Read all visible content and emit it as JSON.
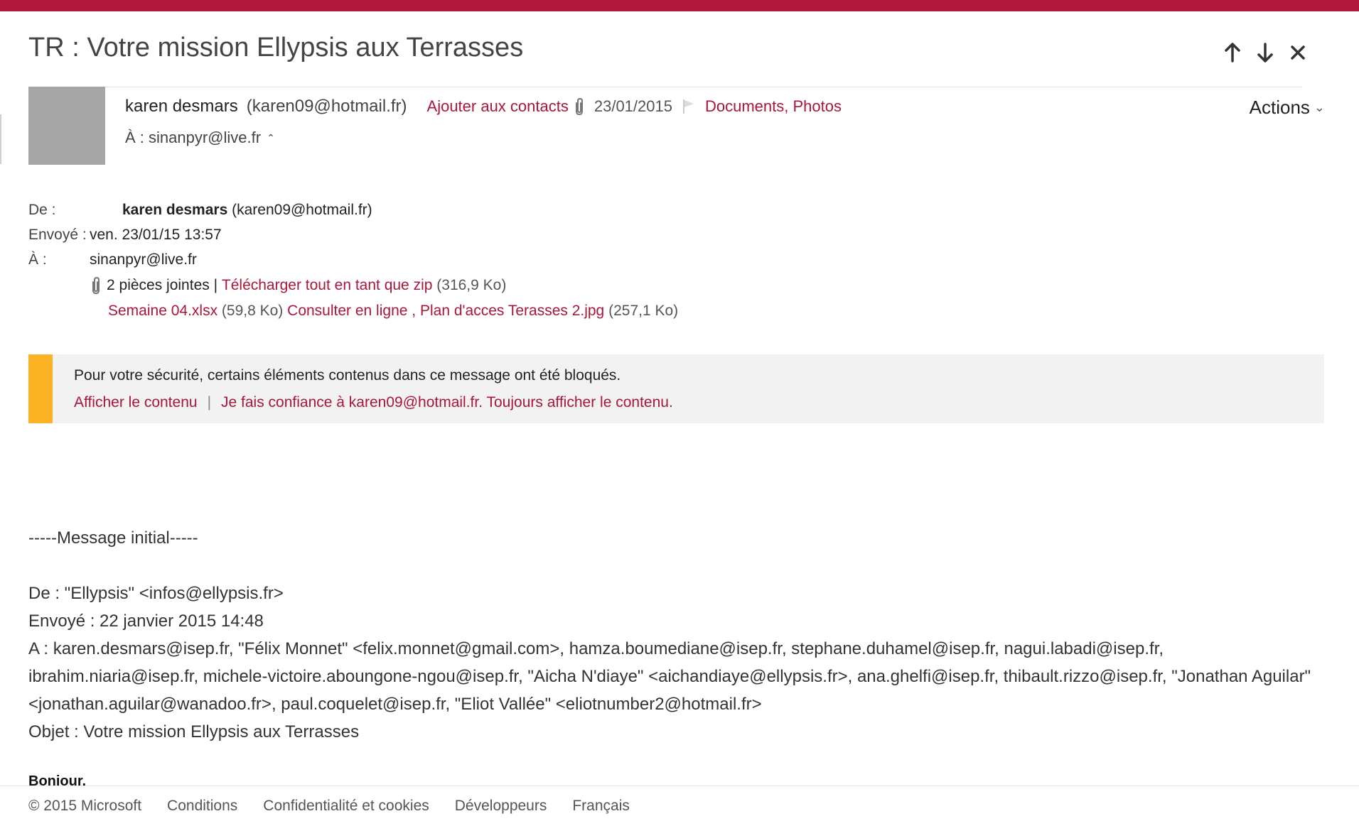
{
  "subject": "TR : Votre mission Ellypsis aux Terrasses",
  "nav": {
    "up_icon": "arrow-up-icon",
    "down_icon": "arrow-down-icon",
    "close_icon": "close-icon"
  },
  "header": {
    "sender_name": "karen desmars",
    "sender_email": "(karen09@hotmail.fr)",
    "add_contact": "Ajouter aux contacts",
    "date": "23/01/2015",
    "categories": "Documents, Photos",
    "recipient": "À : sinanpyr@live.fr",
    "actions": "Actions"
  },
  "meta": {
    "from_label": "De :",
    "from_name": "karen desmars",
    "from_email": "(karen09@hotmail.fr)",
    "sent_label": "Envoyé :",
    "sent_value": "ven. 23/01/15 13:57",
    "to_label": "À :",
    "to_value": "sinanpyr@live.fr"
  },
  "attachments": {
    "count_text": "2 pièces jointes |",
    "download_zip": "Télécharger tout en tant que zip",
    "zip_size": "(316,9 Ko)",
    "file1_name": "Semaine 04.xlsx",
    "file1_size": "(59,8 Ko)",
    "file1_view": "Consulter en ligne",
    "file_sep": ",",
    "file2_name": "Plan d'acces Terasses 2.jpg",
    "file2_size": "(257,1 Ko)"
  },
  "security": {
    "message": "Pour votre sécurité, certains éléments contenus dans ce message ont été bloqués.",
    "show_content": "Afficher le contenu",
    "separator": "|",
    "trust": "Je fais confiance à karen09@hotmail.fr. Toujours afficher le contenu.",
    "accent_color": "#fbb225"
  },
  "body": {
    "initial_marker": "-----Message initial-----",
    "orig_from": "De : \"Ellypsis\" <infos@ellypsis.fr>",
    "orig_sent": "Envoyé : 22 janvier 2015 14:48",
    "orig_to": "A : karen.desmars@isep.fr, \"Félix Monnet\" <felix.monnet@gmail.com>, hamza.boumediane@isep.fr, stephane.duhamel@isep.fr, nagui.labadi@isep.fr, ibrahim.niaria@isep.fr, michele-victoire.aboungone-ngou@isep.fr, \"Aicha N'diaye\" <aichandiaye@ellypsis.fr>, ana.ghelfi@isep.fr, thibault.rizzo@isep.fr, \"Jonathan Aguilar\" <jonathan.aguilar@wanadoo.fr>, paul.coquelet@isep.fr, \"Eliot Vallée\" <eliotnumber2@hotmail.fr>",
    "orig_subject": "Objet : Votre mission Ellypsis aux Terrasses",
    "greeting": "Bonjour,"
  },
  "footer": {
    "copyright": "© 2015 Microsoft",
    "conditions": "Conditions",
    "privacy": "Confidentialité et cookies",
    "developers": "Développeurs",
    "language": "Français"
  },
  "colors": {
    "brand": "#b0183b",
    "link": "#a8173a",
    "avatar": "#a6a6a6"
  }
}
